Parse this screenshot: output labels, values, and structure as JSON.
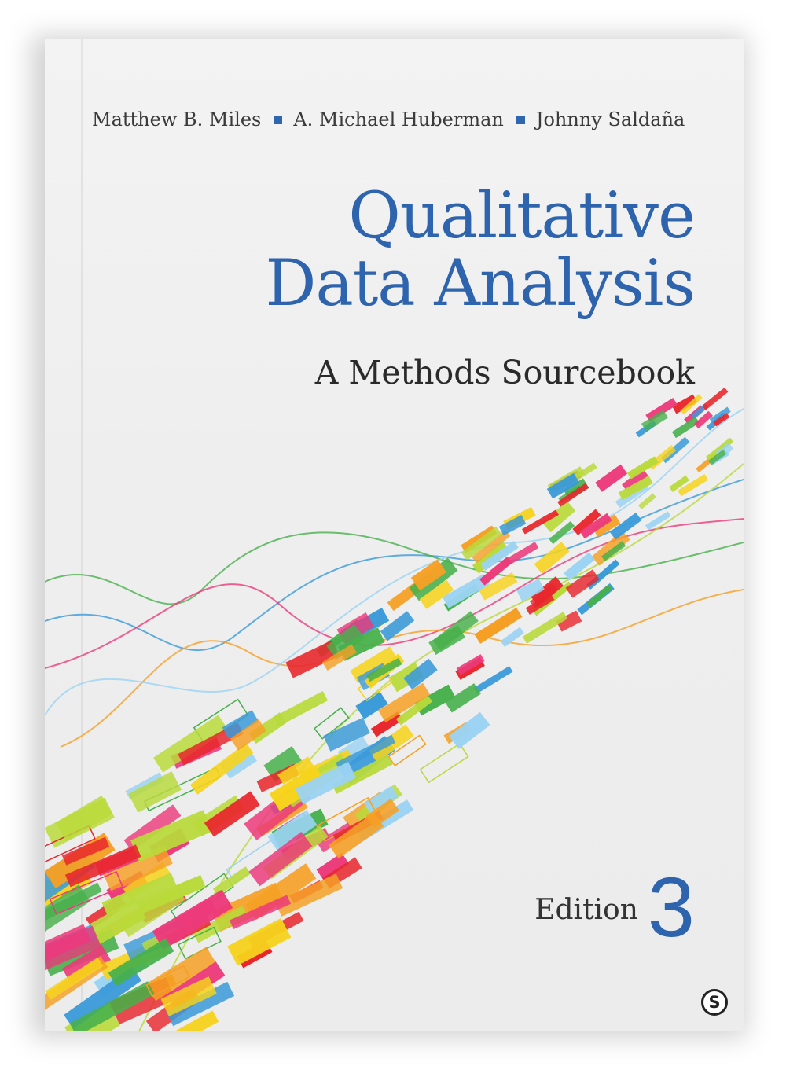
{
  "book": {
    "authors": [
      "Matthew B. Miles",
      "A. Michael Huberman",
      "Johnny Saldaña"
    ],
    "title_line1": "Qualitative",
    "title_line2": "Data Analysis",
    "subtitle": "A Methods Sourcebook",
    "edition_label": "Edition",
    "edition_number": "3",
    "publisher_logo_letter": "S"
  },
  "colors": {
    "title_blue": "#2e64ad",
    "separator_blue": "#2f66b0",
    "art_palette": [
      "#e8262c",
      "#f6d31c",
      "#3a9ad9",
      "#47b04b",
      "#ec3a7a",
      "#f5a025",
      "#9bd3f3",
      "#b9da3b"
    ]
  },
  "icons": {
    "publisher": "sage-logo-icon",
    "author_separator": "blue-square-icon"
  }
}
